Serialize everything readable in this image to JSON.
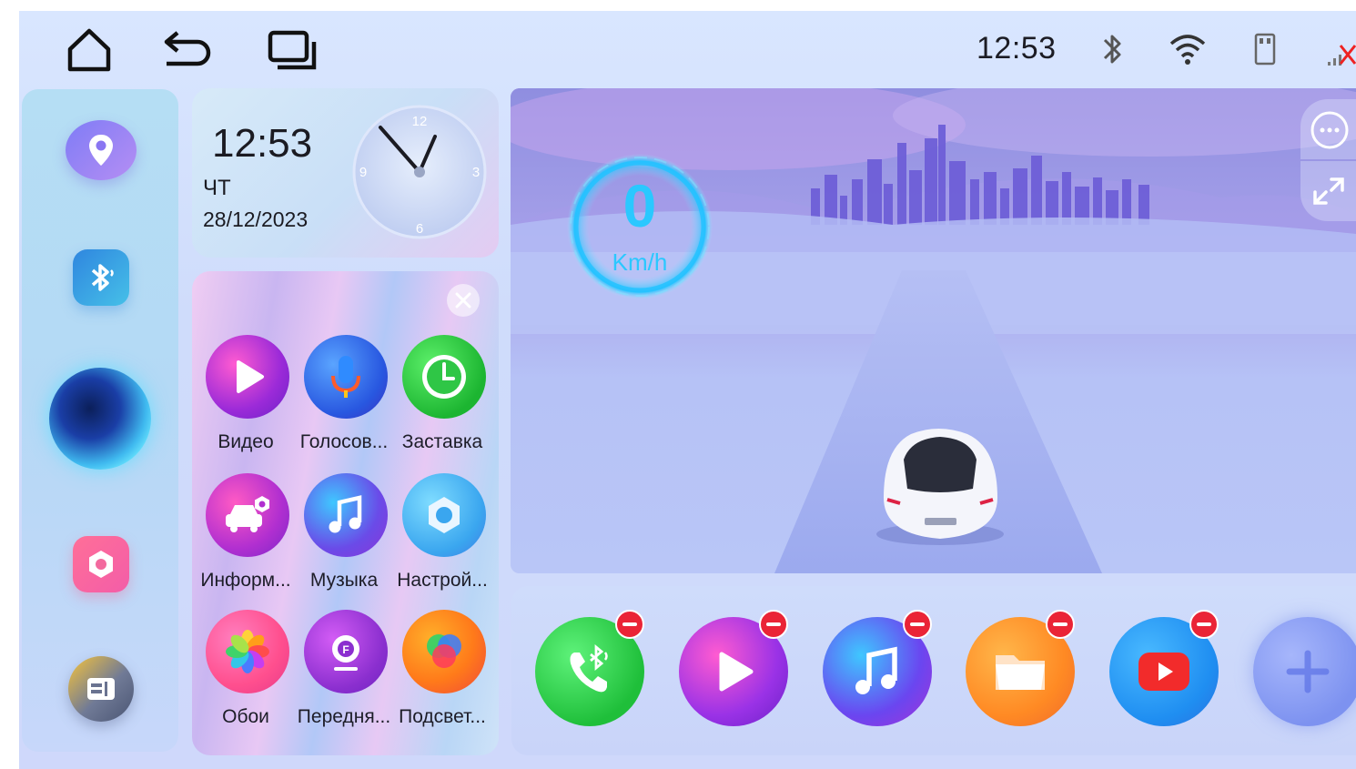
{
  "status_bar": {
    "time": "12:53",
    "nav": [
      "home-icon",
      "back-icon",
      "recents-icon"
    ],
    "icons": [
      "bluetooth-icon",
      "wifi-icon",
      "usb-drive-icon",
      "no-signal-icon"
    ]
  },
  "dock": {
    "items": [
      {
        "name": "navigation",
        "icon": "location-pin-icon"
      },
      {
        "name": "bluetooth",
        "icon": "bluetooth-icon"
      },
      {
        "name": "voice-assistant",
        "icon": "orb-icon"
      },
      {
        "name": "settings",
        "icon": "hexagon-settings-icon"
      },
      {
        "name": "car-info",
        "icon": "car-info-icon"
      }
    ]
  },
  "clock_widget": {
    "time": "12:53",
    "day": "ЧТ",
    "date": "28/12/2023",
    "dial": {
      "n12": "12",
      "n3": "3",
      "n6": "6",
      "n9": "9"
    }
  },
  "apps": [
    {
      "label": "Видео",
      "icon": "video-play-icon",
      "color": "#8a2be2"
    },
    {
      "label": "Голосов...",
      "icon": "microphone-icon",
      "color": "#2e6ee8"
    },
    {
      "label": "Заставка",
      "icon": "clock-icon",
      "color": "#1fb83a"
    },
    {
      "label": "Информ...",
      "icon": "car-settings-icon",
      "color": "#a02fc8"
    },
    {
      "label": "Музыка",
      "icon": "music-note-icon",
      "color": "#6a4be8"
    },
    {
      "label": "Настрой...",
      "icon": "settings-hex-icon",
      "color": "#3aa6ef"
    },
    {
      "label": "Обои",
      "icon": "pinwheel-icon",
      "color": "#ff5f8a"
    },
    {
      "label": "Передня...",
      "icon": "front-camera-icon",
      "color": "#8b2fcf"
    },
    {
      "label": "Подсвет...",
      "icon": "rgb-light-icon",
      "color": "#ff7a1a"
    }
  ],
  "speedometer": {
    "speed": "0",
    "unit": "Km/h"
  },
  "bottom_dock": [
    {
      "name": "bt-phone",
      "icon": "bluetooth-phone-icon",
      "color": "#2ecc40"
    },
    {
      "name": "video",
      "icon": "video-play-icon",
      "color": "#9a32e6"
    },
    {
      "name": "music",
      "icon": "music-note-icon",
      "color": "#6a46f0"
    },
    {
      "name": "files",
      "icon": "folder-icon",
      "color": "#ff8a24"
    },
    {
      "name": "youtube",
      "icon": "youtube-icon",
      "color": "#1f8ef1"
    },
    {
      "name": "add",
      "icon": "plus-icon",
      "color": "#8aa0f4"
    }
  ],
  "colors": {
    "accent": "#1f9df0",
    "speed": "#2ac8ff"
  }
}
